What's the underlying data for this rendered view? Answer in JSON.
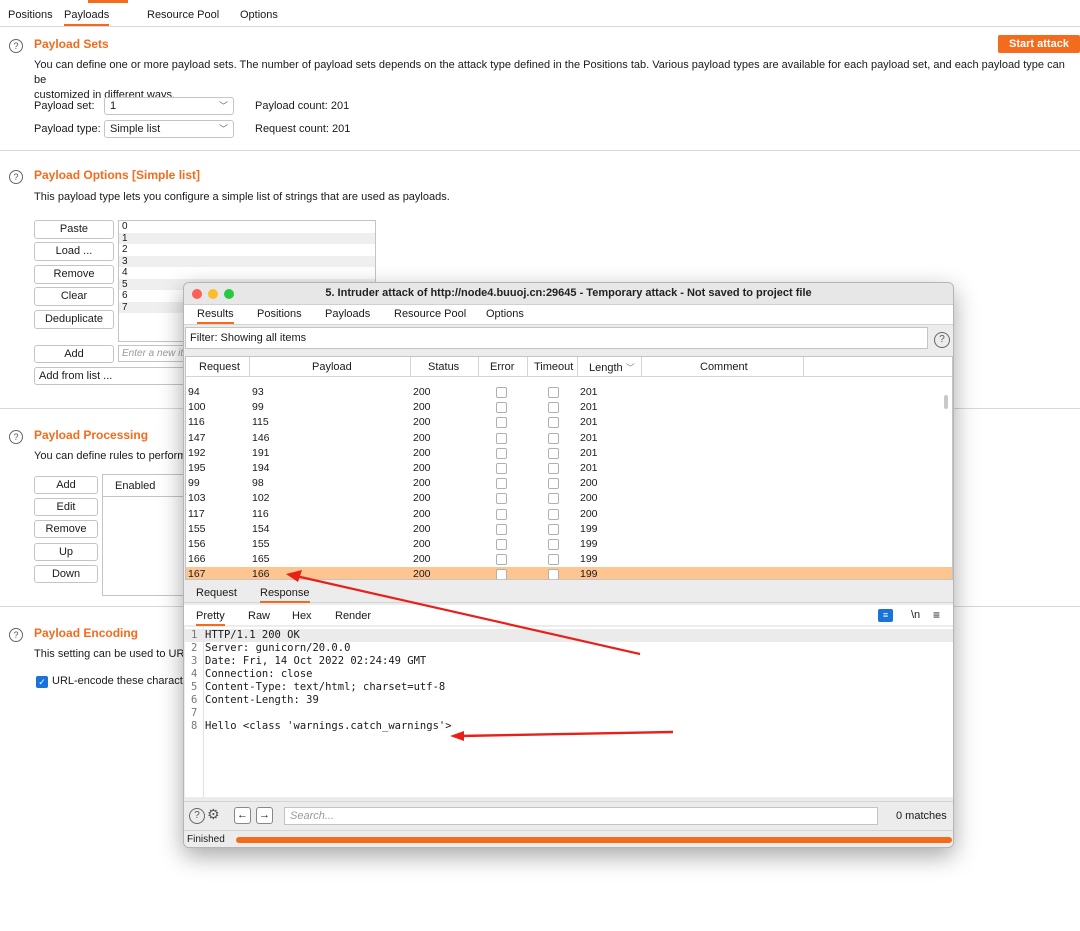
{
  "main": {
    "tabs": [
      "Positions",
      "Payloads",
      "Resource Pool",
      "Options"
    ],
    "active_tab": "Payloads",
    "start_attack": "Start attack",
    "payload_sets": {
      "title": "Payload Sets",
      "desc1": "You can define one or more payload sets. The number of payload sets depends on the attack type defined in the Positions tab. Various payload types are available for each payload set, and each payload type can be",
      "desc2": "customized in different ways.",
      "set_label": "Payload set:",
      "set_value": "1",
      "type_label": "Payload type:",
      "type_value": "Simple list",
      "payload_count": "Payload count: 201",
      "request_count": "Request count: 201"
    },
    "payload_options": {
      "title": "Payload Options [Simple list]",
      "desc": "This payload type lets you configure a simple list of strings that are used as payloads.",
      "buttons": [
        "Paste",
        "Load ...",
        "Remove",
        "Clear",
        "Deduplicate"
      ],
      "list": [
        "0",
        "1",
        "2",
        "3",
        "4",
        "5",
        "6",
        "7"
      ],
      "add_button": "Add",
      "add_placeholder": "Enter a new item",
      "add_from_list": "Add from list ..."
    },
    "payload_processing": {
      "title": "Payload Processing",
      "desc": "You can define rules to perform",
      "buttons": [
        "Add",
        "Edit",
        "Remove",
        "Up",
        "Down"
      ],
      "enabled_header": "Enabled"
    },
    "payload_encoding": {
      "title": "Payload Encoding",
      "desc": "This setting can be used to URL",
      "checkbox_label": "URL-encode these characte"
    }
  },
  "window": {
    "title": "5. Intruder attack of http://node4.buuoj.cn:29645 - Temporary attack - Not saved to project file",
    "tabs": [
      "Results",
      "Positions",
      "Payloads",
      "Resource Pool",
      "Options"
    ],
    "active_tab": "Results",
    "filter": "Filter: Showing all items",
    "columns": [
      "Request",
      "Payload",
      "Status",
      "Error",
      "Timeout",
      "Length",
      "Comment"
    ],
    "rows": [
      {
        "request": "94",
        "payload": "93",
        "status": "200",
        "length": "201"
      },
      {
        "request": "100",
        "payload": "99",
        "status": "200",
        "length": "201"
      },
      {
        "request": "116",
        "payload": "115",
        "status": "200",
        "length": "201"
      },
      {
        "request": "147",
        "payload": "146",
        "status": "200",
        "length": "201"
      },
      {
        "request": "192",
        "payload": "191",
        "status": "200",
        "length": "201"
      },
      {
        "request": "195",
        "payload": "194",
        "status": "200",
        "length": "201"
      },
      {
        "request": "99",
        "payload": "98",
        "status": "200",
        "length": "200"
      },
      {
        "request": "103",
        "payload": "102",
        "status": "200",
        "length": "200"
      },
      {
        "request": "117",
        "payload": "116",
        "status": "200",
        "length": "200"
      },
      {
        "request": "155",
        "payload": "154",
        "status": "200",
        "length": "199"
      },
      {
        "request": "156",
        "payload": "155",
        "status": "200",
        "length": "199"
      },
      {
        "request": "166",
        "payload": "165",
        "status": "200",
        "length": "199"
      },
      {
        "request": "167",
        "payload": "166",
        "status": "200",
        "length": "199",
        "selected": true
      }
    ],
    "resp_tabs": [
      "Request",
      "Response"
    ],
    "active_resp_tab": "Response",
    "view_tabs": [
      "Pretty",
      "Raw",
      "Hex",
      "Render"
    ],
    "active_view_tab": "Pretty",
    "newline_toggle": "\\n",
    "response_lines": [
      "HTTP/1.1 200 OK",
      "Server: gunicorn/20.0.0",
      "Date: Fri, 14 Oct 2022 02:24:49 GMT",
      "Connection: close",
      "Content-Type: text/html; charset=utf-8",
      "Content-Length: 39",
      "",
      "Hello <class 'warnings.catch_warnings'>"
    ],
    "search_placeholder": "Search...",
    "matches": "0 matches",
    "status": "Finished",
    "progress": 1.0
  },
  "colors": {
    "accent": "#f36b1c",
    "selection": "#ffc590",
    "annotation_arrow": "#e8201a"
  }
}
